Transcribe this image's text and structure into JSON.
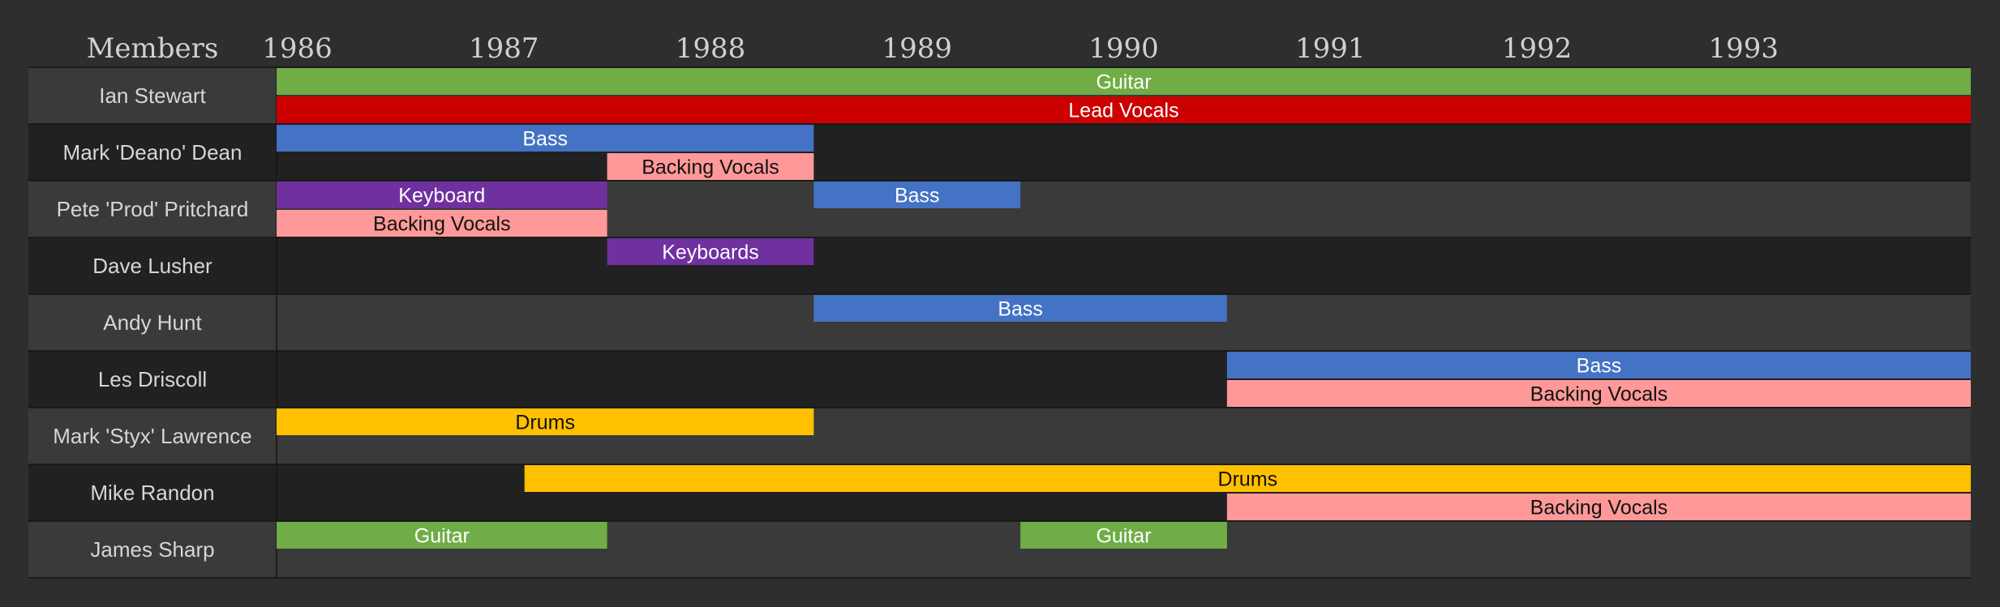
{
  "chart_data": {
    "type": "timeline",
    "header_label": "Members",
    "x_ticks": [
      "1986",
      "1987",
      "1988",
      "1989",
      "1990",
      "1991",
      "1992",
      "1993"
    ],
    "xlim": [
      1985.9,
      1994.1
    ],
    "members": [
      "Ian Stewart",
      "Mark 'Deano' Dean",
      "Pete 'Prod' Pritchard",
      "Dave Lusher",
      "Andy Hunt",
      "Les Driscoll",
      "Mark 'Styx' Lawrence",
      "Mike Randon",
      "James Sharp"
    ],
    "role_colors": {
      "Guitar": "#70ad47",
      "Lead Vocals": "#cc0000",
      "Bass": "#4472c4",
      "Backing Vocals": "#ff9999",
      "Keyboard": "#7030a0",
      "Keyboards": "#7030a0",
      "Drums": "#ffc000"
    },
    "bars": [
      {
        "member": "Ian Stewart",
        "lane": 0,
        "role": "Guitar",
        "start": 1985.9,
        "end": 1994.1
      },
      {
        "member": "Ian Stewart",
        "lane": 1,
        "role": "Lead Vocals",
        "start": 1985.9,
        "end": 1994.1
      },
      {
        "member": "Mark 'Deano' Dean",
        "lane": 0,
        "role": "Bass",
        "start": 1985.9,
        "end": 1988.5
      },
      {
        "member": "Mark 'Deano' Dean",
        "lane": 1,
        "role": "Backing Vocals",
        "start": 1987.5,
        "end": 1988.5
      },
      {
        "member": "Pete 'Prod' Pritchard",
        "lane": 0,
        "role": "Keyboard",
        "start": 1985.9,
        "end": 1987.5
      },
      {
        "member": "Pete 'Prod' Pritchard",
        "lane": 1,
        "role": "Backing Vocals",
        "start": 1985.9,
        "end": 1987.5
      },
      {
        "member": "Pete 'Prod' Pritchard",
        "lane": 0,
        "role": "Bass",
        "start": 1988.5,
        "end": 1989.5
      },
      {
        "member": "Dave Lusher",
        "lane": 0,
        "role": "Keyboards",
        "start": 1987.5,
        "end": 1988.5
      },
      {
        "member": "Andy Hunt",
        "lane": 0,
        "role": "Bass",
        "start": 1988.5,
        "end": 1990.5
      },
      {
        "member": "Les Driscoll",
        "lane": 0,
        "role": "Bass",
        "start": 1990.5,
        "end": 1994.1
      },
      {
        "member": "Les Driscoll",
        "lane": 1,
        "role": "Backing Vocals",
        "start": 1990.5,
        "end": 1994.1
      },
      {
        "member": "Mark 'Styx' Lawrence",
        "lane": 0,
        "role": "Drums",
        "start": 1985.9,
        "end": 1988.5
      },
      {
        "member": "Mike Randon",
        "lane": 0,
        "role": "Drums",
        "start": 1987.1,
        "end": 1994.1
      },
      {
        "member": "Mike Randon",
        "lane": 1,
        "role": "Backing Vocals",
        "start": 1990.5,
        "end": 1994.1
      },
      {
        "member": "James Sharp",
        "lane": 0,
        "role": "Guitar",
        "start": 1985.9,
        "end": 1987.5
      },
      {
        "member": "James Sharp",
        "lane": 0,
        "role": "Guitar",
        "start": 1989.5,
        "end": 1990.5
      }
    ]
  }
}
